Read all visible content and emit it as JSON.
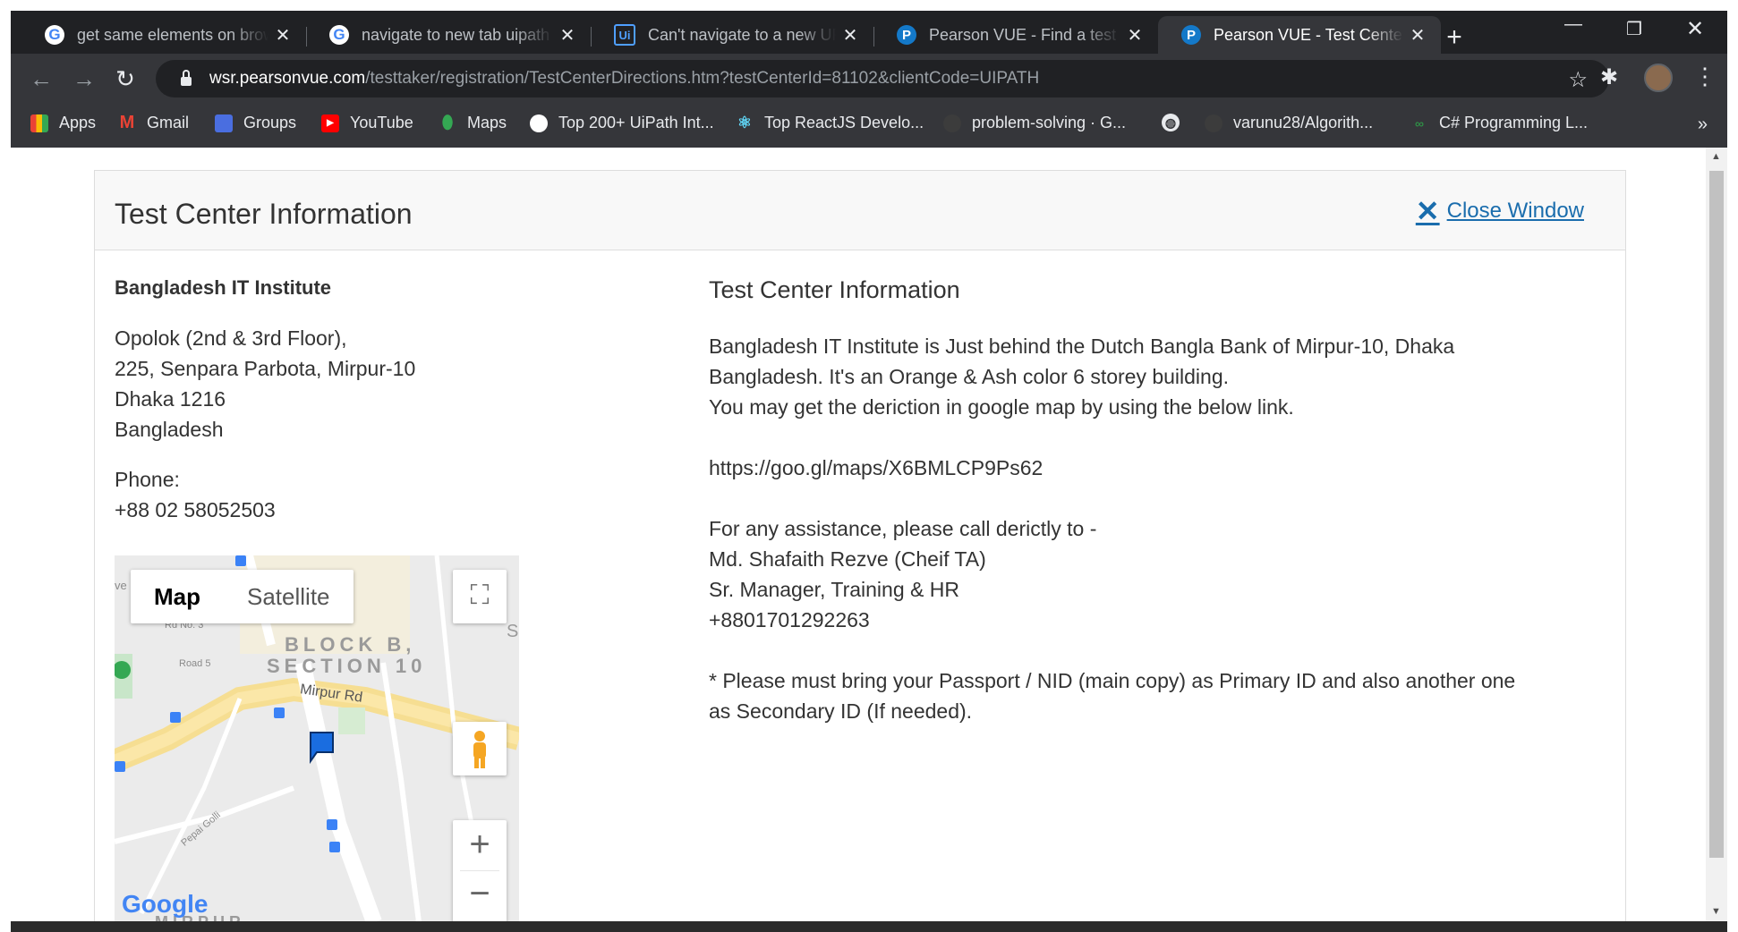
{
  "browser": {
    "tabs": [
      {
        "title": "get same elements on brow",
        "icon": "google"
      },
      {
        "title": "navigate to new tab uipath",
        "icon": "google"
      },
      {
        "title": "Can't navigate to a new URL",
        "icon": "uipath"
      },
      {
        "title": "Pearson VUE - Find a test center",
        "icon": "pearson"
      },
      {
        "title": "Pearson VUE - Test Center Information",
        "icon": "pearson"
      }
    ],
    "icon_letters": {
      "google": "G",
      "uipath": "Ui",
      "pearson": "P"
    },
    "address": {
      "host": "wsr.pearsonvue.com",
      "path": "/testtaker/registration/TestCenterDirections.htm?testCenterId=81102&clientCode=UIPATH"
    },
    "bookmarks": [
      {
        "label": "Apps",
        "icon": "apps-grid"
      },
      {
        "label": "Gmail",
        "icon": "gmail"
      },
      {
        "label": "Groups",
        "icon": "groups"
      },
      {
        "label": "YouTube",
        "icon": "youtube"
      },
      {
        "label": "Maps",
        "icon": "maps"
      },
      {
        "label": "Top 200+ UiPath Int...",
        "icon": "uipath-int"
      },
      {
        "label": "Top ReactJS Develo...",
        "icon": "reactjs"
      },
      {
        "label": "problem-solving · G...",
        "icon": "github"
      },
      {
        "label": "",
        "icon": "globe"
      },
      {
        "label": "varunu28/Algorith...",
        "icon": "github"
      },
      {
        "label": "C# Programming L...",
        "icon": "geeks"
      }
    ]
  },
  "page": {
    "header_title": "Test Center Information",
    "close_label": "Close Window",
    "center_name": "Bangladesh IT Institute",
    "address_lines": [
      "Opolok (2nd & 3rd Floor),",
      "225, Senpara Parbota, Mirpur-10",
      "Dhaka 1216",
      "Bangladesh"
    ],
    "phone_label": "Phone:",
    "phone_value": "+88 02 58052503",
    "info_title": "Test Center Information",
    "info_lines": [
      "Bangladesh IT Institute is Just behind the Dutch Bangla Bank of Mirpur-10, Dhaka",
      "Bangladesh. It's an Orange & Ash color 6 storey building.",
      "You may get the deriction in google map by using the below link.",
      "",
      "https://goo.gl/maps/X6BMLCP9Ps62",
      "",
      "For any assistance, please call derictly to -",
      "Md. Shafaith Rezve (Cheif TA)",
      "Sr. Manager, Training & HR",
      "+8801701292263",
      "",
      "* Please must bring your Passport / NID (main copy) as Primary ID and also another one",
      "as Secondary ID (If needed)."
    ]
  },
  "map": {
    "tab_map": "Map",
    "tab_satellite": "Satellite",
    "road_no3": "Rd No. 3",
    "road5": "Road 5",
    "block": "BLOCK B,",
    "section": "SECTION 10",
    "mirpur_rd": "Mirpur Rd",
    "pepai": "Pepai Golli",
    "google": "Google",
    "bottom_label": "MIRPUR",
    "edge_letter": "S",
    "edge_left": "ve"
  }
}
